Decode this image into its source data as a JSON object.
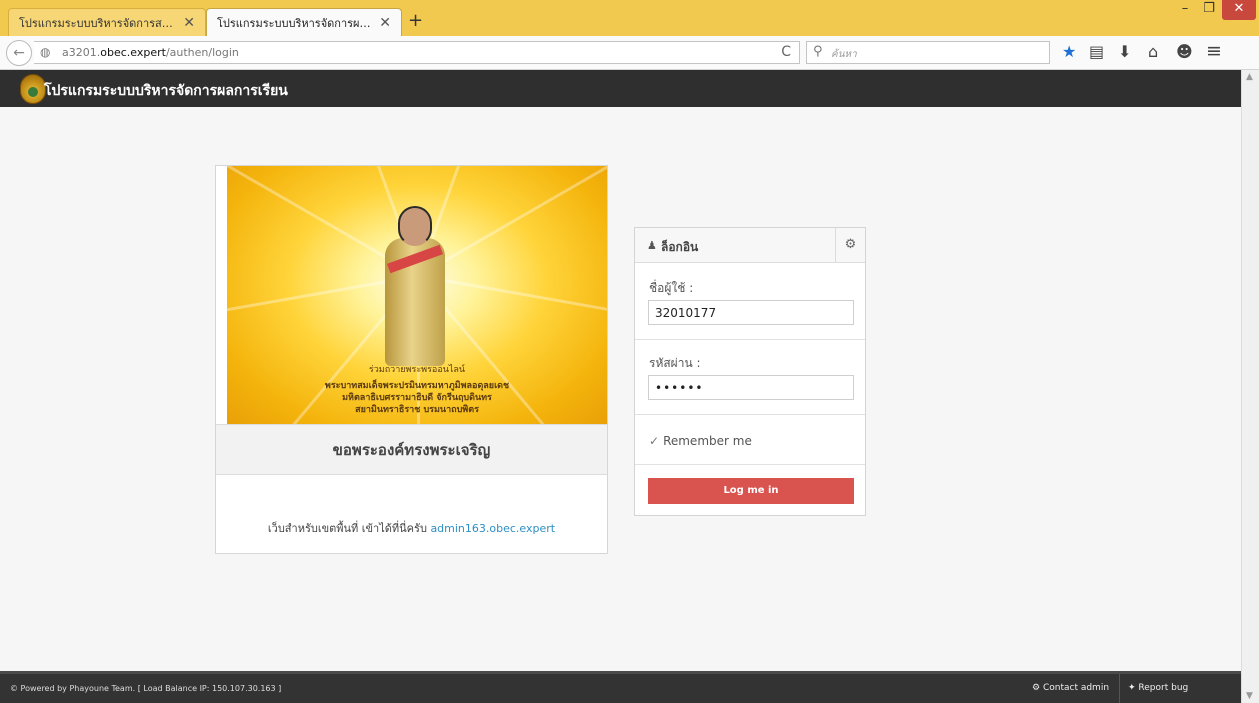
{
  "browser": {
    "tabs": [
      {
        "label": "โปรแกรมระบบบริหารจัดการสถา...",
        "active": false
      },
      {
        "label": "โปรแกรมระบบบริหารจัดการผลก...",
        "active": true
      }
    ],
    "new_tab": "+",
    "url_host_prefix": "a3201.",
    "url_host_domain": "obec.expert",
    "url_path": "/authen/login",
    "search_placeholder": "ค้นหา"
  },
  "icons": {
    "close": "✕",
    "back": "←",
    "globe": "◍",
    "reload": "C",
    "search": "⚲",
    "bookmark_star": "★",
    "reading_list": "▤",
    "download": "⬇",
    "home": "⌂",
    "chat": "☻",
    "menu": "≡",
    "minimize": "–",
    "maximize": "❐",
    "user": "♟",
    "gear": "⚙",
    "check": "✓",
    "cogs": "⚙",
    "bug": "✦"
  },
  "app": {
    "title": "โปรแกรมระบบบริหารจัดการผลการเรียน"
  },
  "promo": {
    "banner_line1": "ร่วมถวายพระพรออนไลน์",
    "banner_line2": "พระบาทสมเด็จพระปรมินทรมหาภูมิพลอดุลยเดช",
    "banner_line3": "มหิตลาธิเบศรรามาธิบดี จักรีนฤบดินทร",
    "banner_line4": "สยามินทราธิราช บรมนาถบพิตร",
    "caption": "ขอพระองค์ทรงพระเจริญ",
    "note_prefix": "เว็บสำหรับเขตพื้นที่ เข้าได้ที่นี่ครับ",
    "note_link": "admin163.obec.expert"
  },
  "login": {
    "title": "ล็อกอิน",
    "username_label": "ชื่อผู้ใช้ :",
    "username_value": "32010177",
    "password_label": "รหัสผ่าน :",
    "password_value": "••••••",
    "remember_label": "Remember me",
    "remember_checked": true,
    "submit_label": "Log me in"
  },
  "footer": {
    "powered": "© Powered by Phayoune Team. [ Load Balance IP: 150.107.30.163 ]",
    "contact": "Contact admin",
    "report": "Report bug"
  },
  "colors": {
    "titlebar": "#f0c94e",
    "header": "#2f2f2f",
    "login_button": "#d9534f",
    "link": "#2f8fc3",
    "close_button": "#c9483d"
  }
}
